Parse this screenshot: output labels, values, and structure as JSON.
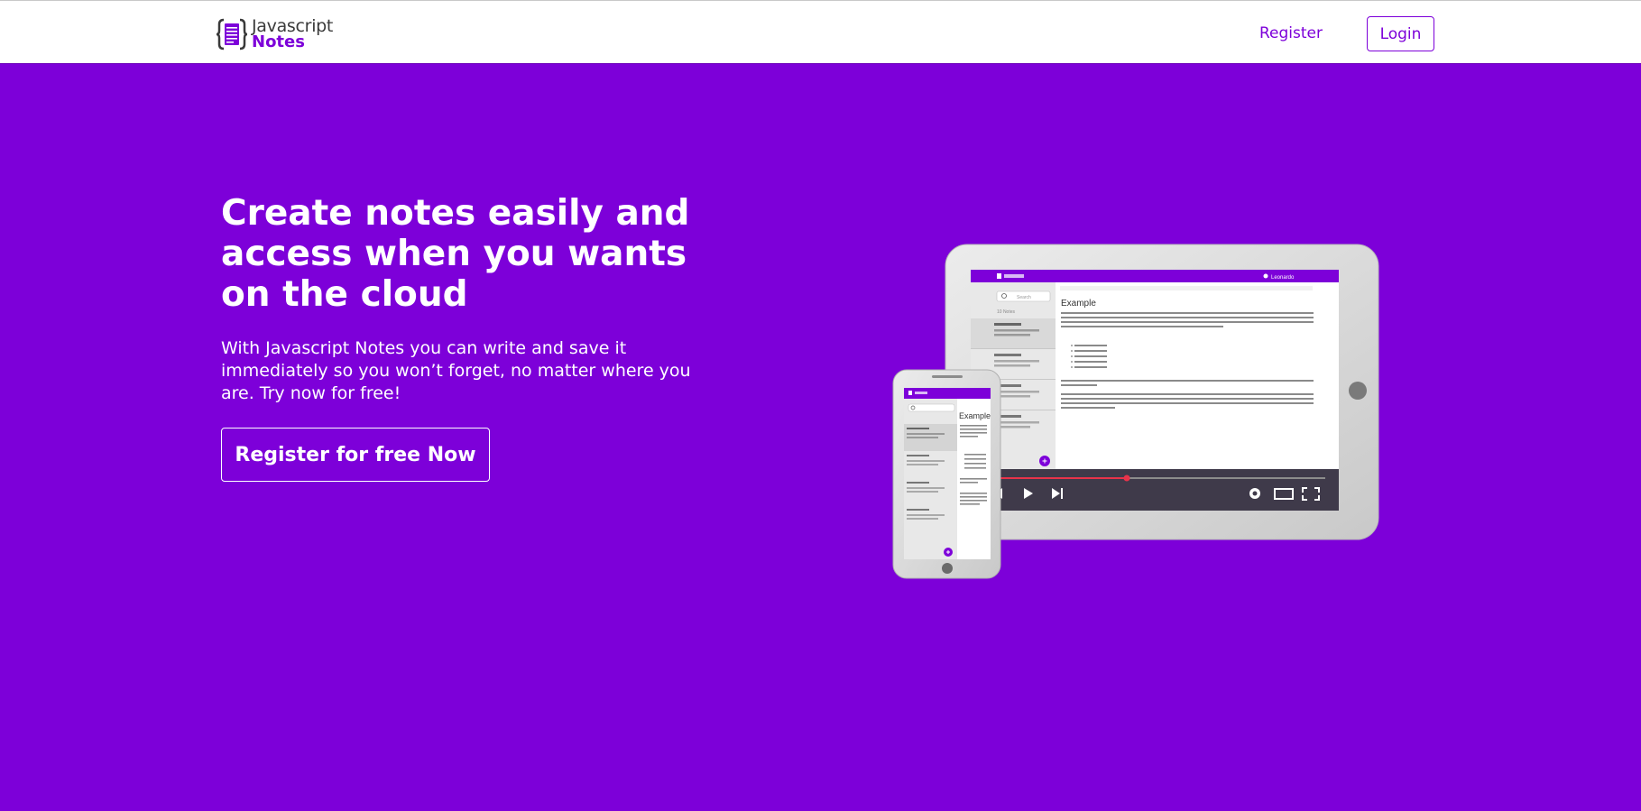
{
  "navbar": {
    "logo": {
      "line1": "Javascript",
      "line2": "Notes"
    },
    "register_label": "Register",
    "login_label": "Login"
  },
  "hero": {
    "title": "Create notes easily and access when you wants on the cloud",
    "subtitle": "With Javascript Notes you can write and save it immediately so you won’t forget, no matter where you are. Try now for free!",
    "cta_label": "Register for free Now"
  },
  "illustration": {
    "tablet": {
      "user_name": "Leonardo",
      "search_placeholder": "Search",
      "notes_count": "10 Notes",
      "note_title": "Example",
      "note_body": "Lorem ipsum dolor sit amet, consectetur adipiscing elit, sed do eiusmod tempor incididunt ut labore et dolore magna aliqua.",
      "bullet": "Lorem ipsum dolor"
    },
    "phone": {
      "note_title": "Example",
      "list_item_title": "Lorem Ipsum",
      "list_item_text": "Long body text - Mauris vel lorem fermentum"
    }
  },
  "colors": {
    "brand": "#7d00d9",
    "white": "#ffffff",
    "video_progress": "#e8334a"
  },
  "icons": [
    "notes-logo-icon",
    "search-icon",
    "user-icon",
    "add-icon",
    "previous-icon",
    "play-icon",
    "next-icon",
    "settings-icon",
    "theater-icon",
    "fullscreen-icon"
  ]
}
